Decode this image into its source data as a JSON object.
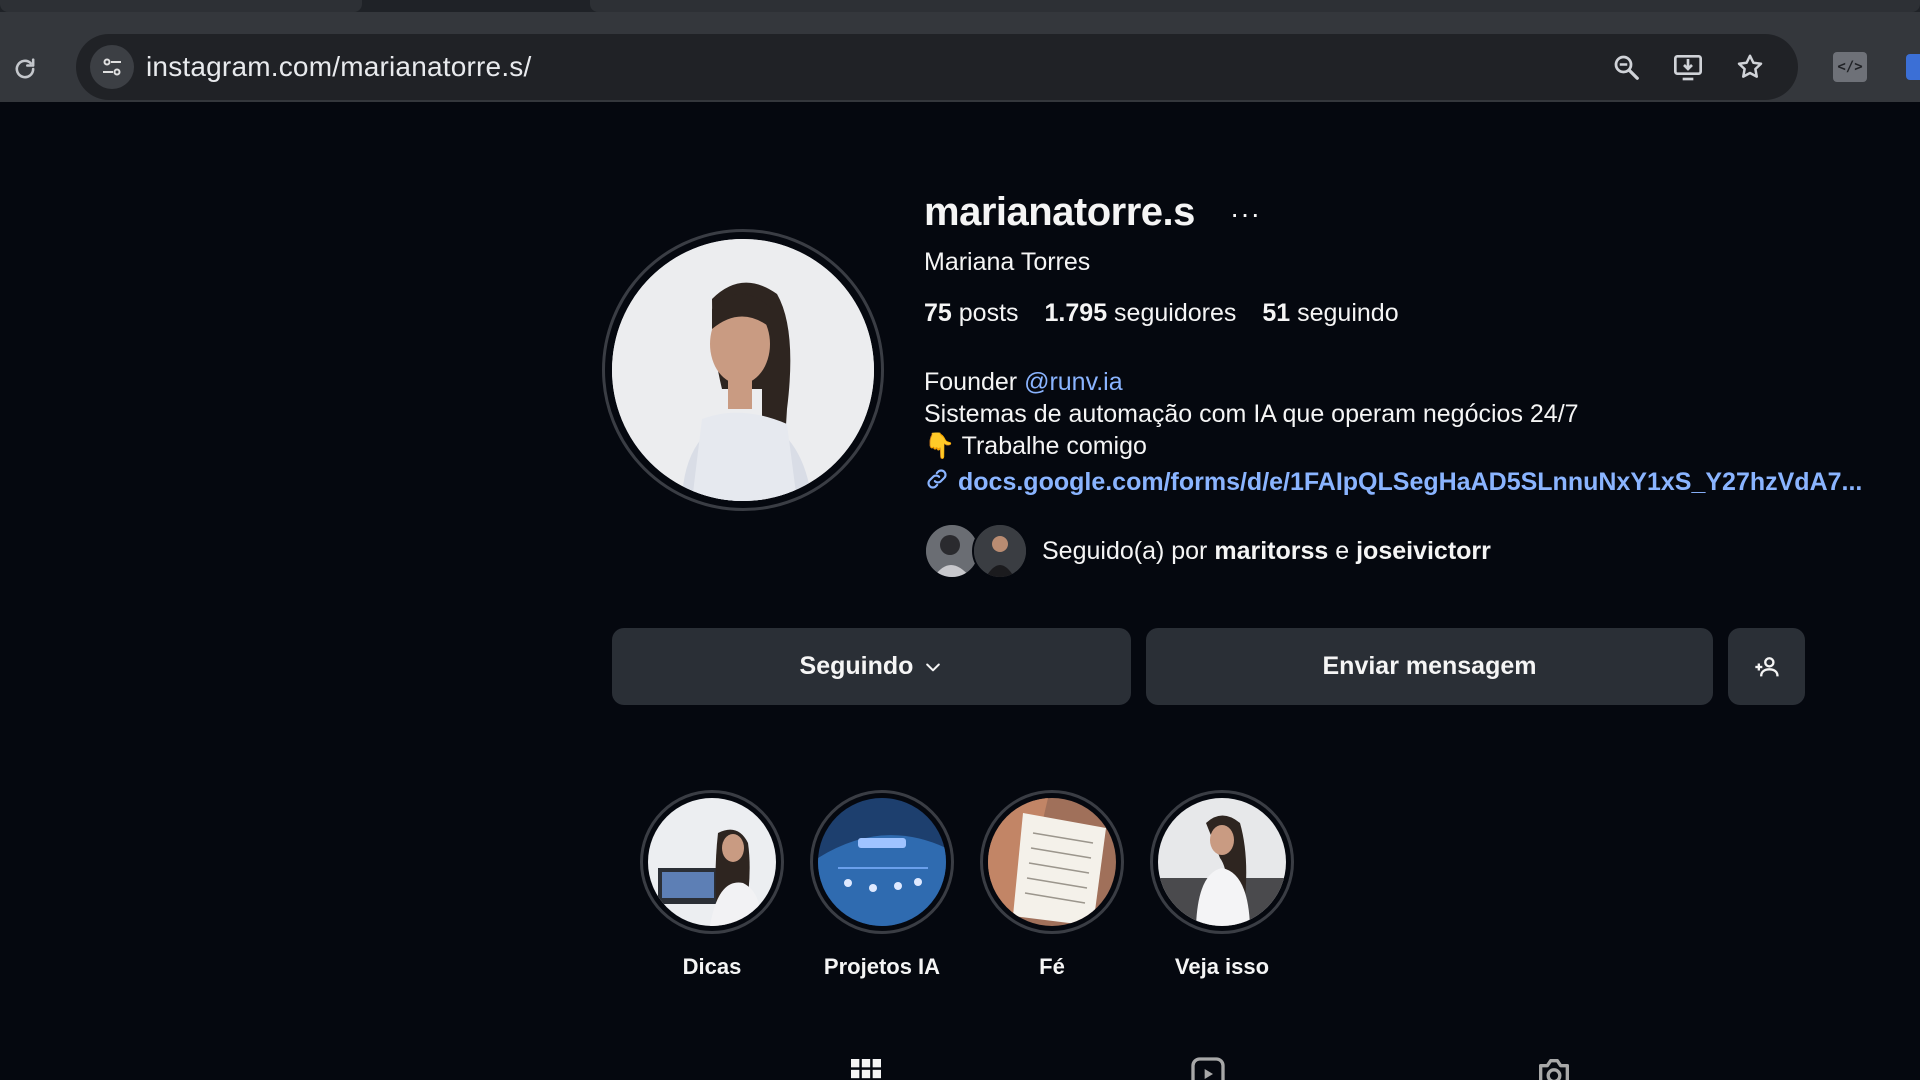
{
  "browser": {
    "url": "instagram.com/marianatorre.s/",
    "icons": [
      "reload-icon",
      "site-info-icon",
      "zoom-icon",
      "install-app-icon",
      "bookmark-star-icon",
      "extension-icon"
    ]
  },
  "profile": {
    "username": "marianatorre.s",
    "more": "···",
    "full_name": "Mariana Torres",
    "stats": {
      "posts_count": "75",
      "posts_label": "posts",
      "followers_count": "1.795",
      "followers_label": "seguidores",
      "following_count": "51",
      "following_label": "seguindo"
    },
    "bio": {
      "founder_prefix": "Founder",
      "founder_mention": "@runv.ia",
      "line2": "Sistemas de automação com IA que operam negócios 24/7",
      "line3_emoji": "👇",
      "line3": "Trabalhe comigo"
    },
    "link": "docs.google.com/forms/d/e/1FAIpQLSegHaAD5SLnnuNxY1xS_Y27hzVdA7...",
    "followed_by": {
      "prefix": "Seguido(a) por",
      "user1": "maritorss",
      "conj": "e",
      "user2": "joseivictorr"
    }
  },
  "actions": {
    "following_label": "Seguindo",
    "message_label": "Enviar mensagem"
  },
  "highlights": [
    {
      "label": "Dicas"
    },
    {
      "label": "Projetos IA"
    },
    {
      "label": "Fé"
    },
    {
      "label": "Veja isso"
    }
  ],
  "tabs": [
    "grid-icon",
    "reels-icon",
    "tagged-icon"
  ]
}
